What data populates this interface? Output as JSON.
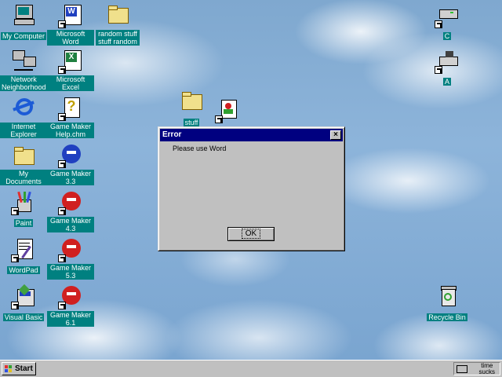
{
  "desktop": {
    "icons": {
      "my_computer": "My Computer",
      "microsoft_word": "Microsoft Word",
      "random_stuff": "random stuff stuff random",
      "network": "Network Neighborhood",
      "microsoft_excel": "Microsoft Excel",
      "internet_explorer": "Internet Explorer",
      "gm_help": "Game Maker Help.chm",
      "my_documents": "My Documents",
      "gm33": "Game Maker 3.3",
      "paint": "Paint",
      "gm43": "Game Maker 4.3",
      "wordpad": "WordPad",
      "gm53": "Game Maker 5.3",
      "visual_basic": "Visual Basic",
      "gm61": "Game Maker 6.1",
      "stuff": "stuff",
      "drive_c": "C",
      "drive_a": "A",
      "recycle_bin": "Recycle Bin"
    }
  },
  "dialog": {
    "title": "Error",
    "close": "×",
    "message": "Please use Word",
    "ok_label": "OK"
  },
  "taskbar": {
    "start_label": "Start",
    "clock_line1": "time",
    "clock_line2": "sucks"
  },
  "colors": {
    "label_bg": "#008080",
    "titlebar": "#000080",
    "face": "#c0c0c0"
  }
}
